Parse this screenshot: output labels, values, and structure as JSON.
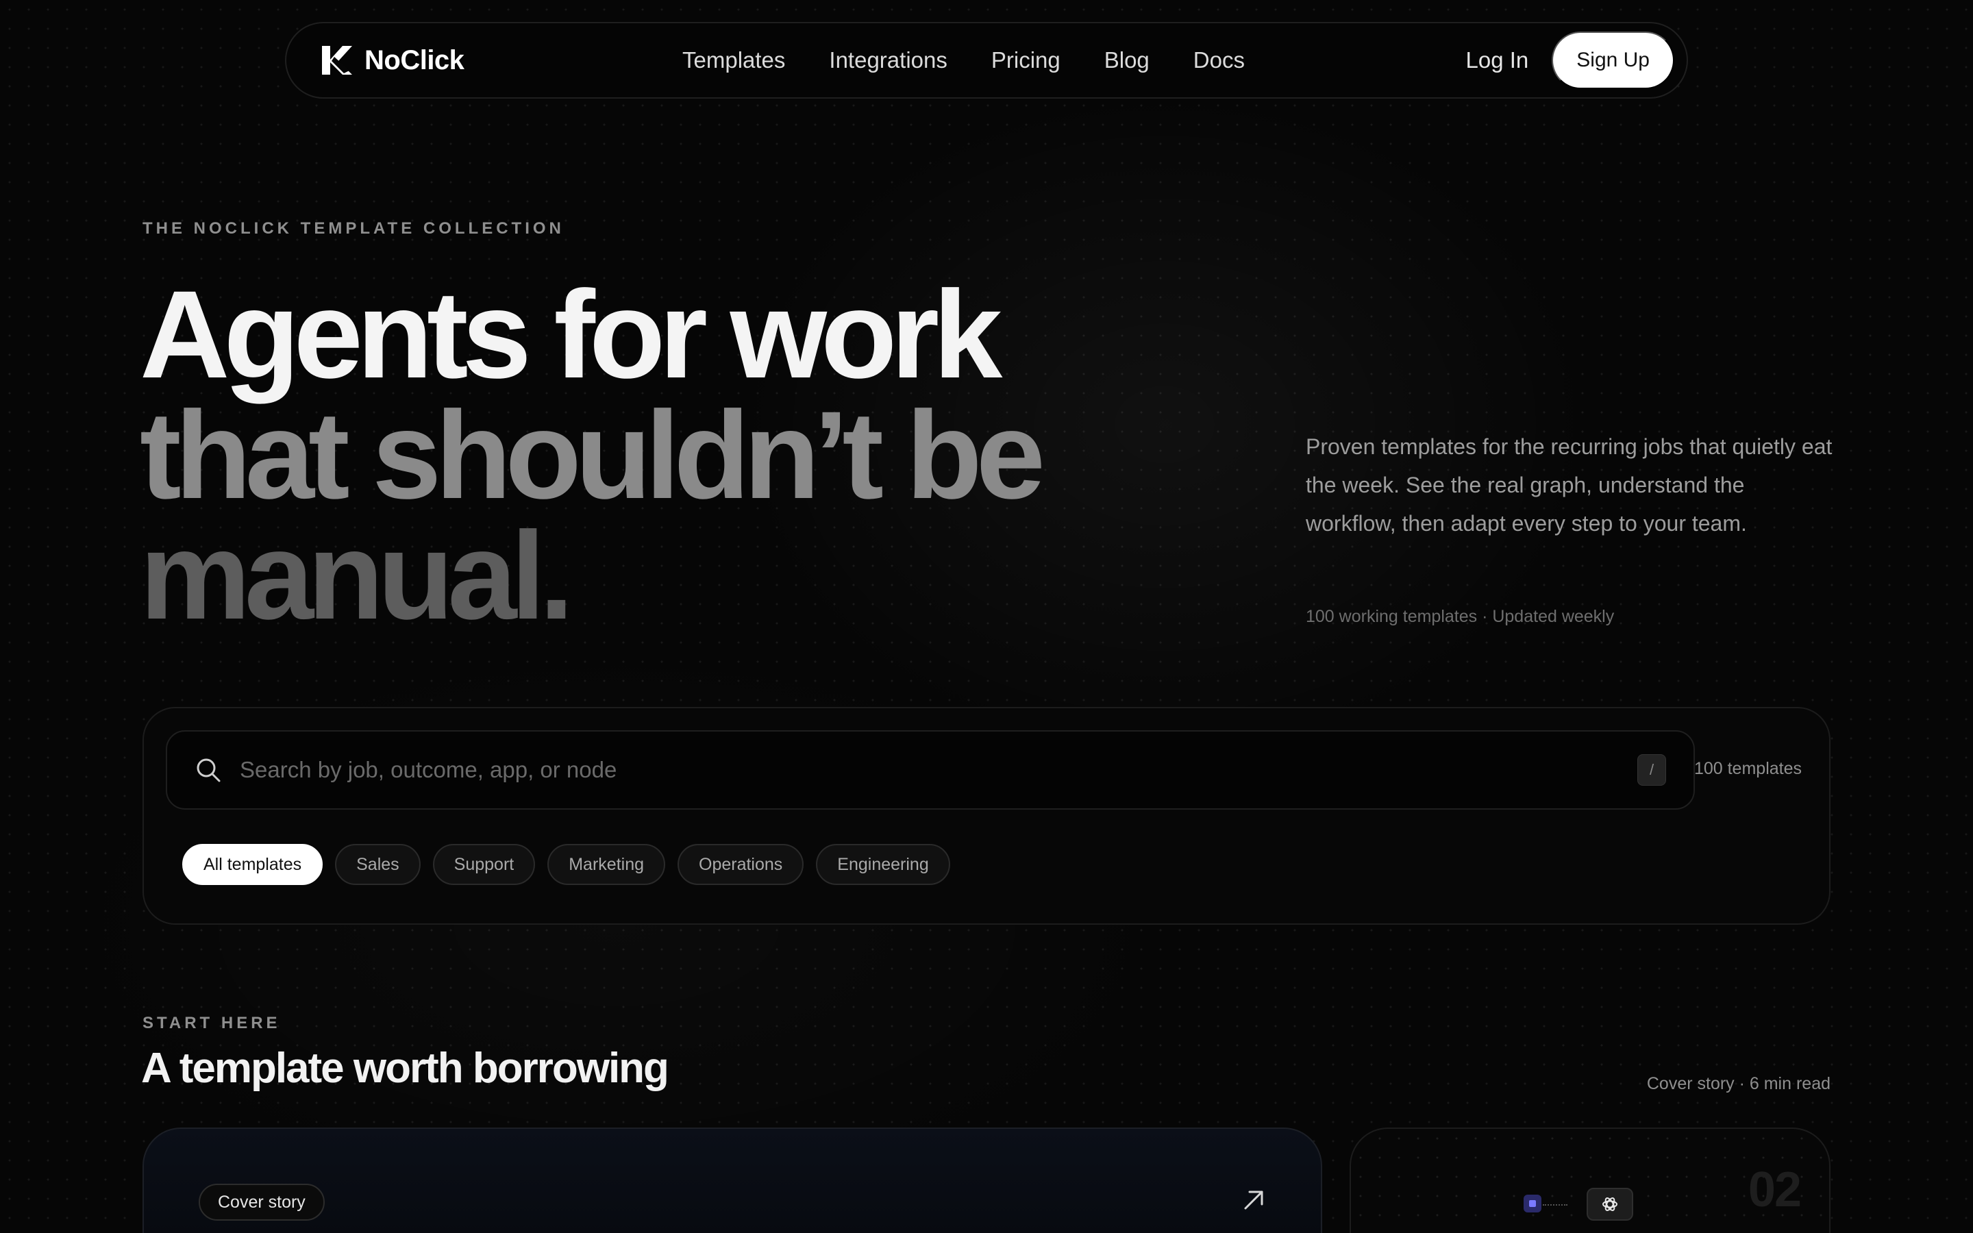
{
  "nav": {
    "brand": "NoClick",
    "links": [
      "Templates",
      "Integrations",
      "Pricing",
      "Blog",
      "Docs"
    ],
    "login": "Log In",
    "signup": "Sign Up"
  },
  "hero": {
    "eyebrow": "THE NOCLICK TEMPLATE COLLECTION",
    "line1": "Agents for work",
    "line2": "that shouldn’t be",
    "line3": "manual.",
    "intro": "Proven templates for the recurring jobs that quietly eat the week. See the real graph, understand the workflow, then adapt every step to your team.",
    "meta": "100 working templates · Updated weekly"
  },
  "search": {
    "placeholder": "Search by job, outcome, app, or node",
    "shortcut": "/",
    "count": "100 templates",
    "chips": [
      "All templates",
      "Sales",
      "Support",
      "Marketing",
      "Operations",
      "Engineering"
    ],
    "active_chip": "All templates"
  },
  "start": {
    "eyebrow": "START HERE",
    "title": "A template worth borrowing",
    "meta": "Cover story · 6 min read",
    "badge": "Cover story",
    "side_number": "02"
  },
  "icons": {
    "logo": "noclick-logo-icon",
    "search": "search-icon",
    "arrow": "arrow-up-right-icon",
    "openai": "openai-icon"
  }
}
